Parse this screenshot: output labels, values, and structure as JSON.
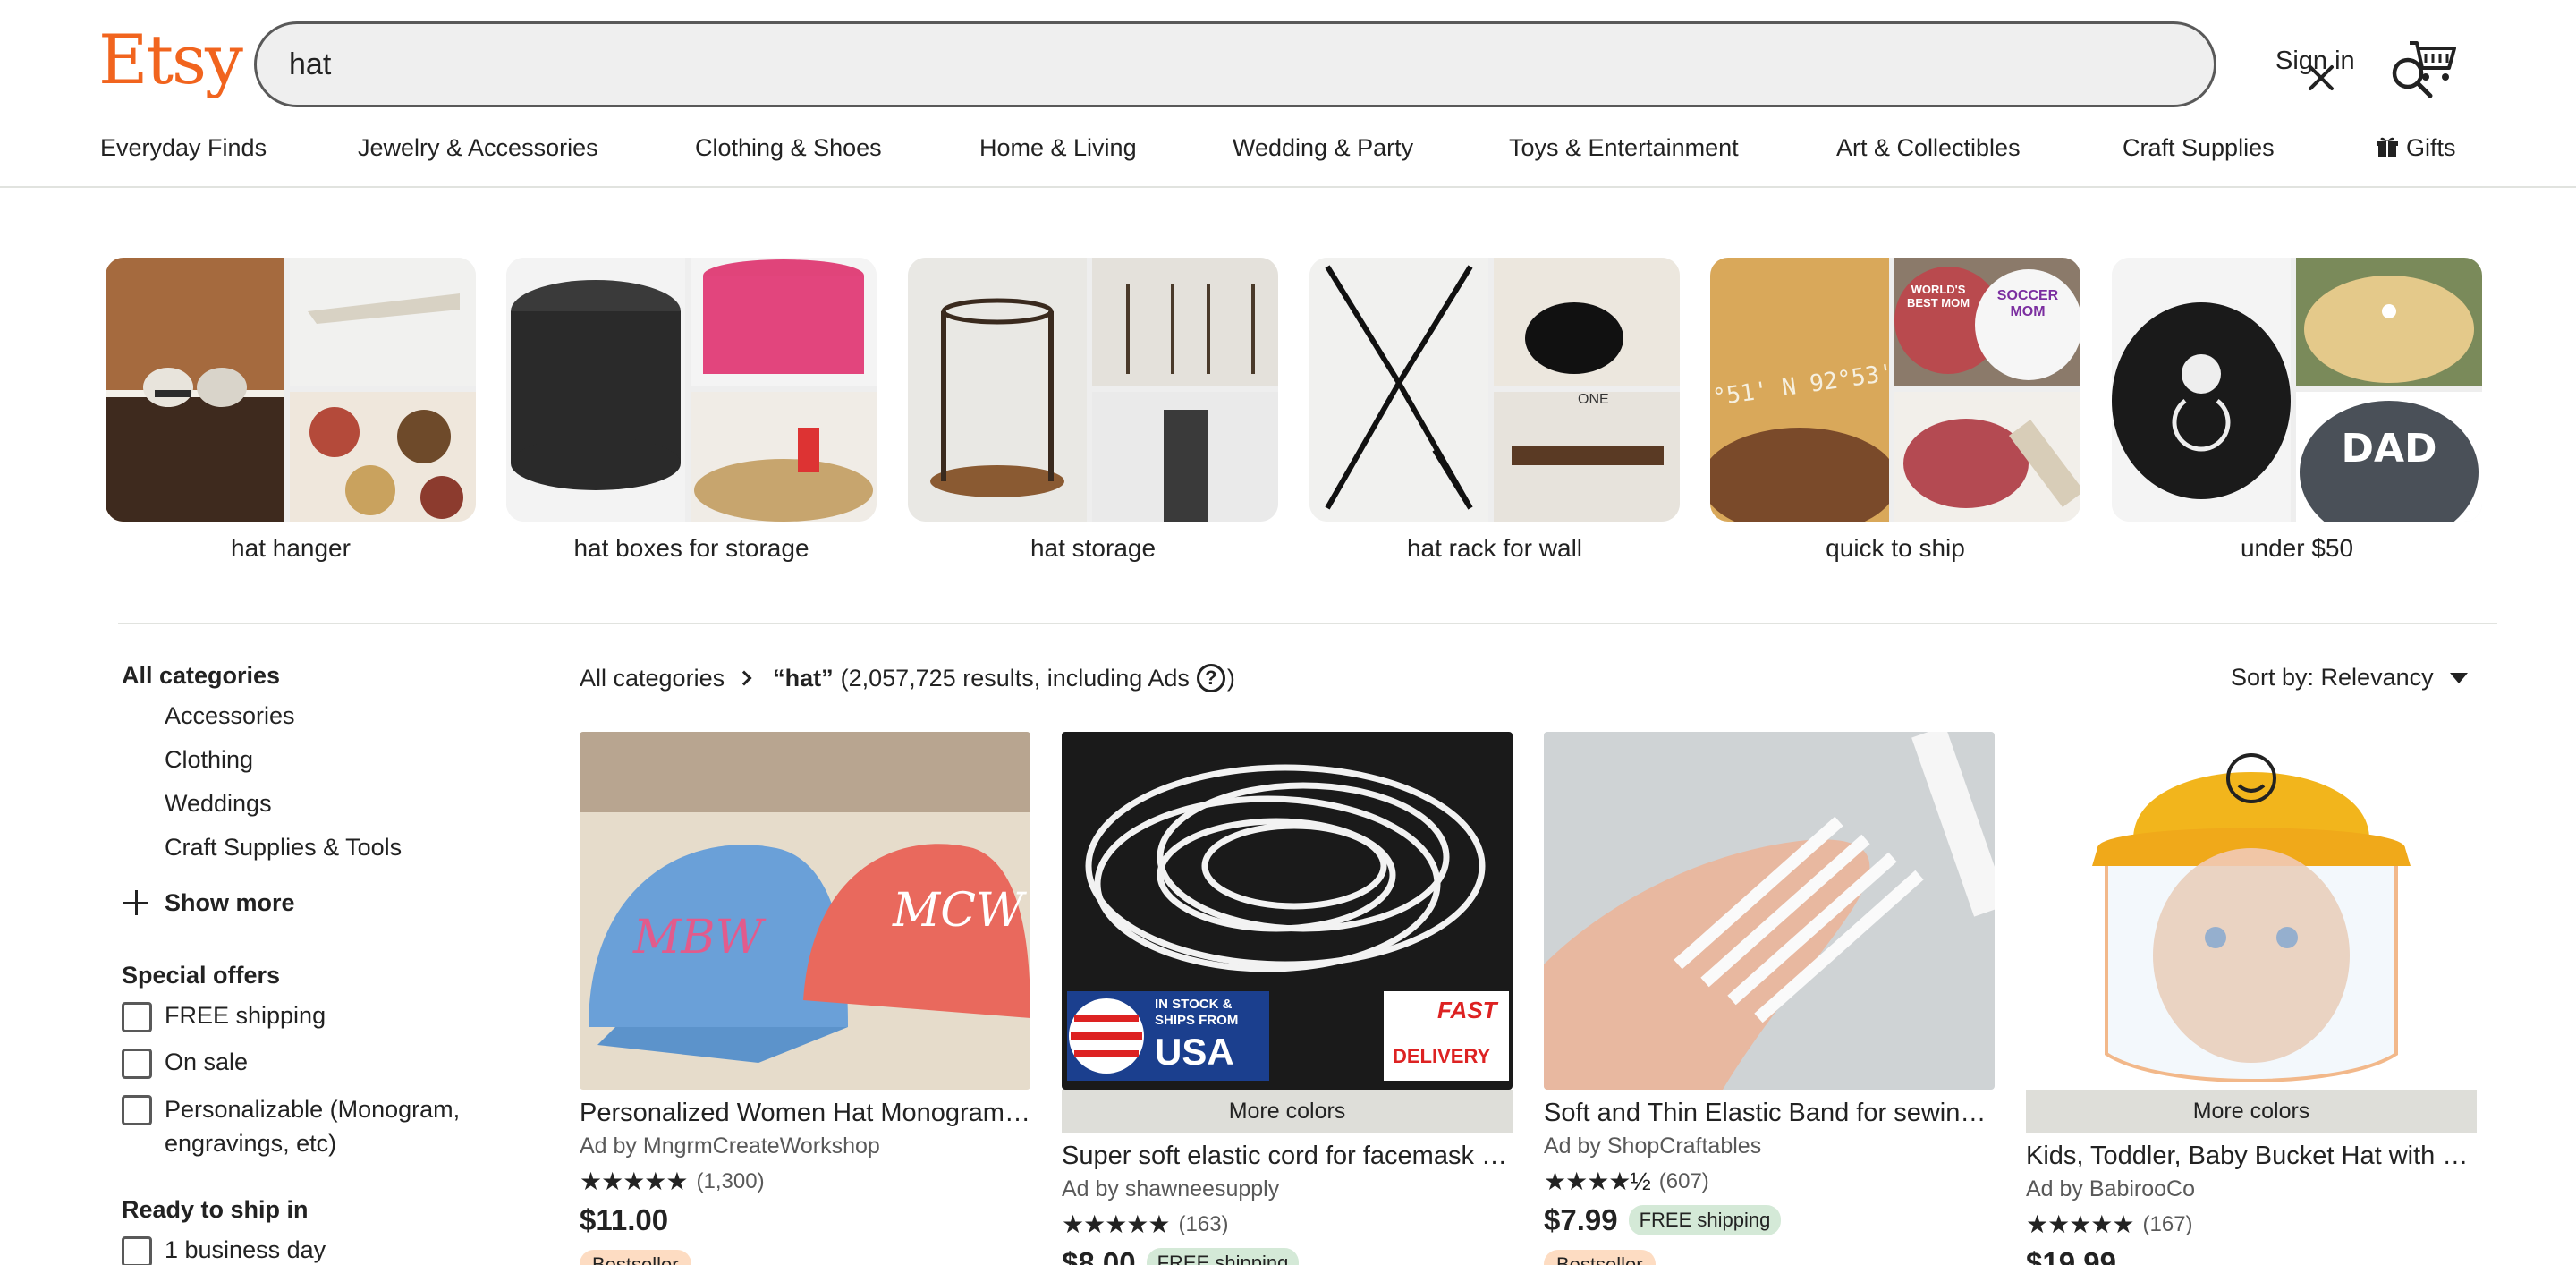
{
  "header": {
    "logo": "Etsy",
    "search_value": "hat",
    "sign_in": "Sign in"
  },
  "nav": [
    "Everyday Finds",
    "Jewelry & Accessories",
    "Clothing & Shoes",
    "Home & Living",
    "Wedding & Party",
    "Toys & Entertainment",
    "Art & Collectibles",
    "Craft Supplies",
    "Gifts"
  ],
  "tiles": [
    {
      "label": "hat hanger"
    },
    {
      "label": "hat boxes for storage"
    },
    {
      "label": "hat storage"
    },
    {
      "label": "hat rack for wall"
    },
    {
      "label": "quick to ship"
    },
    {
      "label": "under $50"
    }
  ],
  "tile_image_texts": {
    "mom_cap": "WORLD'S BEST MOM",
    "soccer_cap": "SOCCER MOM",
    "dad_cap": "DAD",
    "coords": "°51' N 92°53'",
    "box_label": "ONE"
  },
  "sidebar": {
    "categories_heading": "All categories",
    "categories": [
      "Accessories",
      "Clothing",
      "Weddings",
      "Craft Supplies & Tools"
    ],
    "show_more": "Show more",
    "special_offers_heading": "Special offers",
    "offers": [
      "FREE shipping",
      "On sale",
      "Personalizable (Monogram, engravings, etc)"
    ],
    "ready_heading": "Ready to ship in",
    "ready_options": [
      "1 business day"
    ]
  },
  "results": {
    "crumb_root": "All categories",
    "query": "“hat”",
    "count_text": "(2,057,725 results, including Ads",
    "close_paren": ")",
    "help_glyph": "?",
    "sort_label": "Sort by: Relevancy"
  },
  "listings": [
    {
      "title": "Personalized Women Hat Monogram Baseball Cap",
      "seller": "Ad by MngrmCreateWorkshop",
      "stars": "★★★★★",
      "reviews": "(1,300)",
      "price": "$11.00",
      "free_shipping": "",
      "badge": "Bestseller",
      "more_colors": "",
      "img_text_1": "MCW",
      "img_text_2": "MBW"
    },
    {
      "title": "Super soft elastic cord for facemask making",
      "seller": "Ad by shawneesupply",
      "stars": "★★★★★",
      "reviews": "(163)",
      "price": "$8.00",
      "free_shipping": "FREE shipping",
      "badge": "",
      "more_colors": "More colors",
      "img_text_1": "IN STOCK & SHIPS FROM",
      "img_text_2": "USA",
      "img_text_3": "FAST",
      "img_text_4": "DELIVERY"
    },
    {
      "title": "Soft and Thin Elastic Band for sewing face masks",
      "seller": "Ad by ShopCraftables",
      "stars": "★★★★½",
      "reviews": "(607)",
      "price": "$7.99",
      "free_shipping": "FREE shipping",
      "badge": "Bestseller",
      "more_colors": ""
    },
    {
      "title": "Kids, Toddler, Baby Bucket Hat with Face Shield",
      "seller": "Ad by BabirooCo",
      "stars": "★★★★★",
      "reviews": "(167)",
      "price": "$19.99",
      "free_shipping": "",
      "badge": "",
      "more_colors": "More colors"
    }
  ],
  "colors": {
    "brand": "#f1641e",
    "free_ship_bg": "#d4e9d7",
    "bestseller_bg": "#fddcc2"
  }
}
